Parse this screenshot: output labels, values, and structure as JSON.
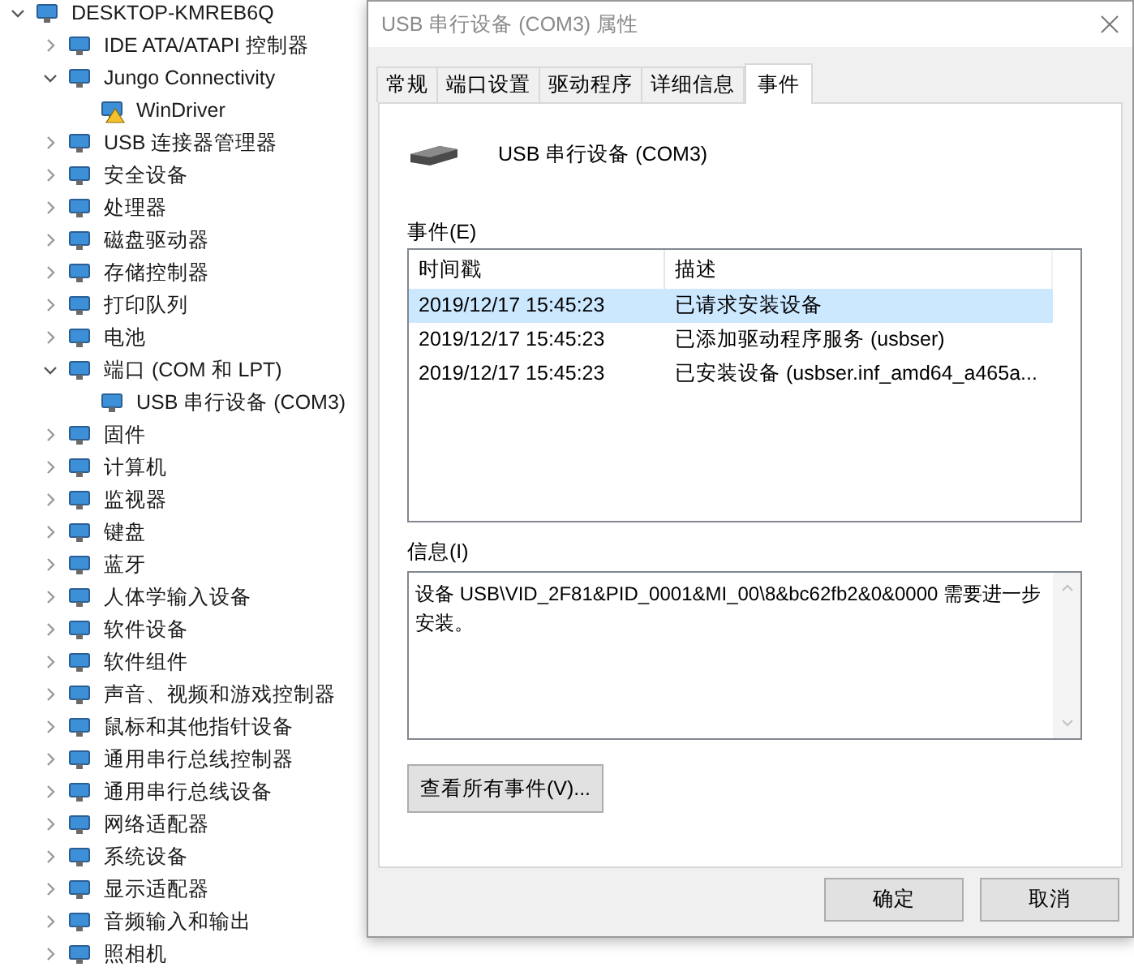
{
  "tree": {
    "label": "DESKTOP-KMREB6Q",
    "expanded": true,
    "children": [
      {
        "label": "IDE ATA/ATAPI 控制器",
        "expanded": false
      },
      {
        "label": "Jungo Connectivity",
        "expanded": true,
        "children": [
          {
            "label": "WinDriver",
            "warning": true
          }
        ]
      },
      {
        "label": "USB 连接器管理器",
        "expanded": false
      },
      {
        "label": "安全设备",
        "expanded": false
      },
      {
        "label": "处理器",
        "expanded": false
      },
      {
        "label": "磁盘驱动器",
        "expanded": false
      },
      {
        "label": "存储控制器",
        "expanded": false
      },
      {
        "label": "打印队列",
        "expanded": false
      },
      {
        "label": "电池",
        "expanded": false
      },
      {
        "label": "端口 (COM 和 LPT)",
        "expanded": true,
        "children": [
          {
            "label": "USB 串行设备 (COM3)",
            "warning": false
          }
        ]
      },
      {
        "label": "固件",
        "expanded": false
      },
      {
        "label": "计算机",
        "expanded": false
      },
      {
        "label": "监视器",
        "expanded": false
      },
      {
        "label": "键盘",
        "expanded": false
      },
      {
        "label": "蓝牙",
        "expanded": false
      },
      {
        "label": "人体学输入设备",
        "expanded": false
      },
      {
        "label": "软件设备",
        "expanded": false
      },
      {
        "label": "软件组件",
        "expanded": false
      },
      {
        "label": "声音、视频和游戏控制器",
        "expanded": false
      },
      {
        "label": "鼠标和其他指针设备",
        "expanded": false
      },
      {
        "label": "通用串行总线控制器",
        "expanded": false
      },
      {
        "label": "通用串行总线设备",
        "expanded": false
      },
      {
        "label": "网络适配器",
        "expanded": false
      },
      {
        "label": "系统设备",
        "expanded": false
      },
      {
        "label": "显示适配器",
        "expanded": false
      },
      {
        "label": "音频输入和输出",
        "expanded": false
      },
      {
        "label": "照相机",
        "expanded": false
      }
    ]
  },
  "dialog": {
    "title": "USB 串行设备 (COM3) 属性",
    "tabs": [
      {
        "label": "常规",
        "selected": false
      },
      {
        "label": "端口设置",
        "selected": false
      },
      {
        "label": "驱动程序",
        "selected": false
      },
      {
        "label": "详细信息",
        "selected": false
      },
      {
        "label": "事件",
        "selected": true
      }
    ],
    "device_name": "USB 串行设备 (COM3)",
    "events_label": "事件(E)",
    "events_table": {
      "columns": [
        "时间戳",
        "描述"
      ],
      "rows": [
        {
          "cells": [
            "2019/12/17 15:45:23",
            "已请求安装设备"
          ],
          "selected": true
        },
        {
          "cells": [
            "2019/12/17 15:45:23",
            "已添加驱动程序服务 (usbser)"
          ],
          "selected": false
        },
        {
          "cells": [
            "2019/12/17 15:45:23",
            "已安装设备 (usbser.inf_amd64_a465a..."
          ],
          "selected": false
        }
      ]
    },
    "info_label": "信息(I)",
    "info_text": "设备 USB\\VID_2F81&PID_0001&MI_00\\8&bc62fb2&0&0000 需要进一步安装。",
    "view_all_button": "查看所有事件(V)...",
    "buttons": [
      "确定",
      "取消"
    ]
  }
}
